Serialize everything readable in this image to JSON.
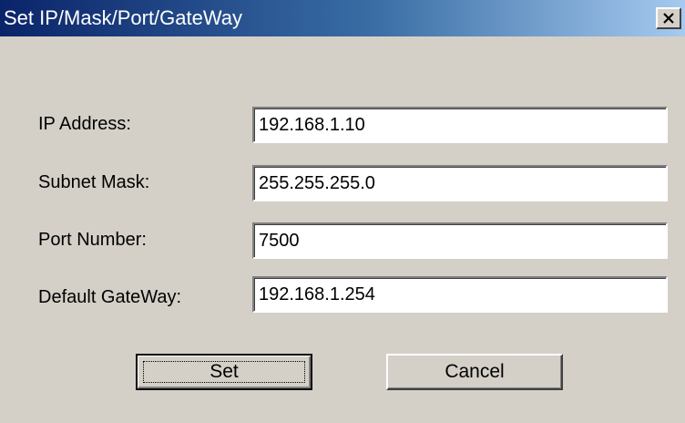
{
  "window": {
    "title": "Set IP/Mask/Port/GateWay",
    "close_icon": "close-icon"
  },
  "form": {
    "fields": [
      {
        "label": "IP Address:",
        "value": "192.168.1.10"
      },
      {
        "label": "Subnet Mask:",
        "value": "255.255.255.0"
      },
      {
        "label": "Port Number:",
        "value": "7500"
      },
      {
        "label": "Default GateWay:",
        "value": "192.168.1.254"
      }
    ]
  },
  "buttons": {
    "set_label": "Set",
    "cancel_label": "Cancel"
  }
}
